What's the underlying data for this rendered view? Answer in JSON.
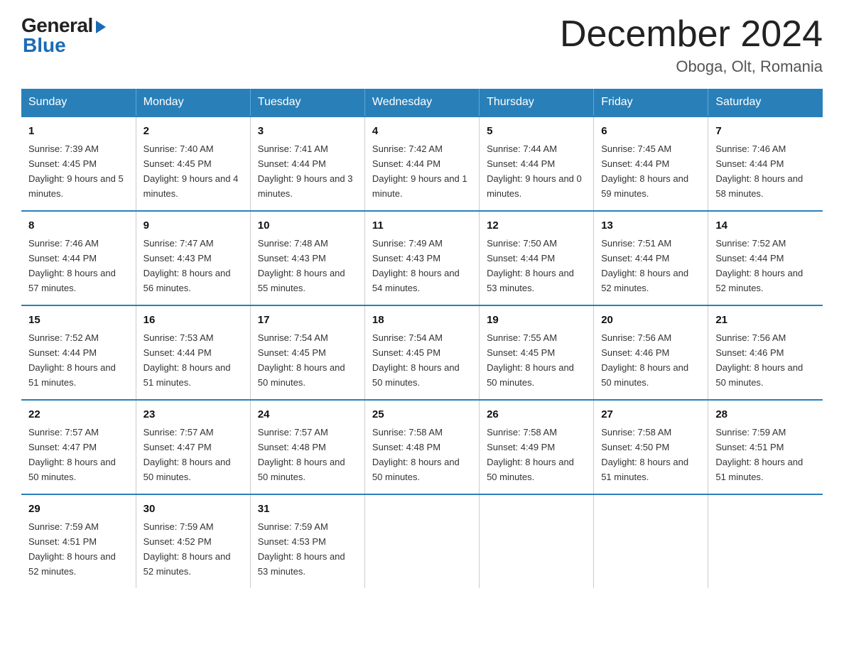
{
  "logo": {
    "general": "General",
    "blue": "Blue"
  },
  "title": "December 2024",
  "location": "Oboga, Olt, Romania",
  "headers": [
    "Sunday",
    "Monday",
    "Tuesday",
    "Wednesday",
    "Thursday",
    "Friday",
    "Saturday"
  ],
  "weeks": [
    [
      {
        "day": "1",
        "sunrise": "7:39 AM",
        "sunset": "4:45 PM",
        "daylight": "9 hours and 5 minutes."
      },
      {
        "day": "2",
        "sunrise": "7:40 AM",
        "sunset": "4:45 PM",
        "daylight": "9 hours and 4 minutes."
      },
      {
        "day": "3",
        "sunrise": "7:41 AM",
        "sunset": "4:44 PM",
        "daylight": "9 hours and 3 minutes."
      },
      {
        "day": "4",
        "sunrise": "7:42 AM",
        "sunset": "4:44 PM",
        "daylight": "9 hours and 1 minute."
      },
      {
        "day": "5",
        "sunrise": "7:44 AM",
        "sunset": "4:44 PM",
        "daylight": "9 hours and 0 minutes."
      },
      {
        "day": "6",
        "sunrise": "7:45 AM",
        "sunset": "4:44 PM",
        "daylight": "8 hours and 59 minutes."
      },
      {
        "day": "7",
        "sunrise": "7:46 AM",
        "sunset": "4:44 PM",
        "daylight": "8 hours and 58 minutes."
      }
    ],
    [
      {
        "day": "8",
        "sunrise": "7:46 AM",
        "sunset": "4:44 PM",
        "daylight": "8 hours and 57 minutes."
      },
      {
        "day": "9",
        "sunrise": "7:47 AM",
        "sunset": "4:43 PM",
        "daylight": "8 hours and 56 minutes."
      },
      {
        "day": "10",
        "sunrise": "7:48 AM",
        "sunset": "4:43 PM",
        "daylight": "8 hours and 55 minutes."
      },
      {
        "day": "11",
        "sunrise": "7:49 AM",
        "sunset": "4:43 PM",
        "daylight": "8 hours and 54 minutes."
      },
      {
        "day": "12",
        "sunrise": "7:50 AM",
        "sunset": "4:44 PM",
        "daylight": "8 hours and 53 minutes."
      },
      {
        "day": "13",
        "sunrise": "7:51 AM",
        "sunset": "4:44 PM",
        "daylight": "8 hours and 52 minutes."
      },
      {
        "day": "14",
        "sunrise": "7:52 AM",
        "sunset": "4:44 PM",
        "daylight": "8 hours and 52 minutes."
      }
    ],
    [
      {
        "day": "15",
        "sunrise": "7:52 AM",
        "sunset": "4:44 PM",
        "daylight": "8 hours and 51 minutes."
      },
      {
        "day": "16",
        "sunrise": "7:53 AM",
        "sunset": "4:44 PM",
        "daylight": "8 hours and 51 minutes."
      },
      {
        "day": "17",
        "sunrise": "7:54 AM",
        "sunset": "4:45 PM",
        "daylight": "8 hours and 50 minutes."
      },
      {
        "day": "18",
        "sunrise": "7:54 AM",
        "sunset": "4:45 PM",
        "daylight": "8 hours and 50 minutes."
      },
      {
        "day": "19",
        "sunrise": "7:55 AM",
        "sunset": "4:45 PM",
        "daylight": "8 hours and 50 minutes."
      },
      {
        "day": "20",
        "sunrise": "7:56 AM",
        "sunset": "4:46 PM",
        "daylight": "8 hours and 50 minutes."
      },
      {
        "day": "21",
        "sunrise": "7:56 AM",
        "sunset": "4:46 PM",
        "daylight": "8 hours and 50 minutes."
      }
    ],
    [
      {
        "day": "22",
        "sunrise": "7:57 AM",
        "sunset": "4:47 PM",
        "daylight": "8 hours and 50 minutes."
      },
      {
        "day": "23",
        "sunrise": "7:57 AM",
        "sunset": "4:47 PM",
        "daylight": "8 hours and 50 minutes."
      },
      {
        "day": "24",
        "sunrise": "7:57 AM",
        "sunset": "4:48 PM",
        "daylight": "8 hours and 50 minutes."
      },
      {
        "day": "25",
        "sunrise": "7:58 AM",
        "sunset": "4:48 PM",
        "daylight": "8 hours and 50 minutes."
      },
      {
        "day": "26",
        "sunrise": "7:58 AM",
        "sunset": "4:49 PM",
        "daylight": "8 hours and 50 minutes."
      },
      {
        "day": "27",
        "sunrise": "7:58 AM",
        "sunset": "4:50 PM",
        "daylight": "8 hours and 51 minutes."
      },
      {
        "day": "28",
        "sunrise": "7:59 AM",
        "sunset": "4:51 PM",
        "daylight": "8 hours and 51 minutes."
      }
    ],
    [
      {
        "day": "29",
        "sunrise": "7:59 AM",
        "sunset": "4:51 PM",
        "daylight": "8 hours and 52 minutes."
      },
      {
        "day": "30",
        "sunrise": "7:59 AM",
        "sunset": "4:52 PM",
        "daylight": "8 hours and 52 minutes."
      },
      {
        "day": "31",
        "sunrise": "7:59 AM",
        "sunset": "4:53 PM",
        "daylight": "8 hours and 53 minutes."
      },
      null,
      null,
      null,
      null
    ]
  ]
}
